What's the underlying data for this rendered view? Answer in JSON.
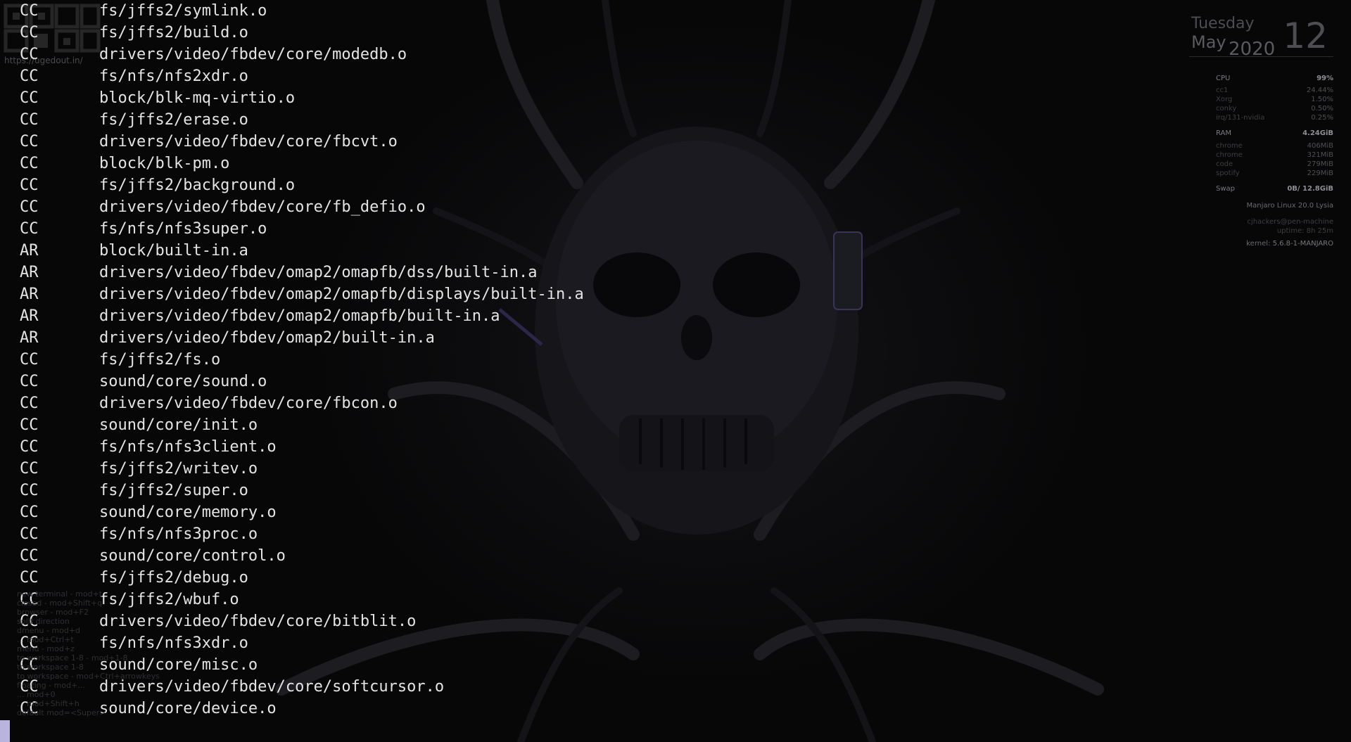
{
  "terminal": {
    "lines": [
      {
        "cmd": "CC",
        "path": "fs/jffs2/symlink.o"
      },
      {
        "cmd": "CC",
        "path": "fs/jffs2/build.o"
      },
      {
        "cmd": "CC",
        "path": "drivers/video/fbdev/core/modedb.o"
      },
      {
        "cmd": "CC",
        "path": "fs/nfs/nfs2xdr.o"
      },
      {
        "cmd": "CC",
        "path": "block/blk-mq-virtio.o"
      },
      {
        "cmd": "CC",
        "path": "fs/jffs2/erase.o"
      },
      {
        "cmd": "CC",
        "path": "drivers/video/fbdev/core/fbcvt.o"
      },
      {
        "cmd": "CC",
        "path": "block/blk-pm.o"
      },
      {
        "cmd": "CC",
        "path": "fs/jffs2/background.o"
      },
      {
        "cmd": "CC",
        "path": "drivers/video/fbdev/core/fb_defio.o"
      },
      {
        "cmd": "CC",
        "path": "fs/nfs/nfs3super.o"
      },
      {
        "cmd": "AR",
        "path": "block/built-in.a"
      },
      {
        "cmd": "AR",
        "path": "drivers/video/fbdev/omap2/omapfb/dss/built-in.a"
      },
      {
        "cmd": "AR",
        "path": "drivers/video/fbdev/omap2/omapfb/displays/built-in.a"
      },
      {
        "cmd": "AR",
        "path": "drivers/video/fbdev/omap2/omapfb/built-in.a"
      },
      {
        "cmd": "AR",
        "path": "drivers/video/fbdev/omap2/built-in.a"
      },
      {
        "cmd": "CC",
        "path": "fs/jffs2/fs.o"
      },
      {
        "cmd": "CC",
        "path": "sound/core/sound.o"
      },
      {
        "cmd": "CC",
        "path": "drivers/video/fbdev/core/fbcon.o"
      },
      {
        "cmd": "CC",
        "path": "sound/core/init.o"
      },
      {
        "cmd": "CC",
        "path": "fs/nfs/nfs3client.o"
      },
      {
        "cmd": "CC",
        "path": "fs/jffs2/writev.o"
      },
      {
        "cmd": "CC",
        "path": "fs/jffs2/super.o"
      },
      {
        "cmd": "CC",
        "path": "sound/core/memory.o"
      },
      {
        "cmd": "CC",
        "path": "fs/nfs/nfs3proc.o"
      },
      {
        "cmd": "CC",
        "path": "sound/core/control.o"
      },
      {
        "cmd": "CC",
        "path": "fs/jffs2/debug.o"
      },
      {
        "cmd": "CC",
        "path": "fs/jffs2/wbuf.o"
      },
      {
        "cmd": "CC",
        "path": "drivers/video/fbdev/core/bitblit.o"
      },
      {
        "cmd": "CC",
        "path": "fs/nfs/nfs3xdr.o"
      },
      {
        "cmd": "CC",
        "path": "sound/core/misc.o"
      },
      {
        "cmd": "CC",
        "path": "drivers/video/fbdev/core/softcursor.o"
      },
      {
        "cmd": "CC",
        "path": "sound/core/device.o"
      }
    ]
  },
  "logo": {
    "url": "https://ugedout.in/"
  },
  "hints": [
    "new terminal - mod+t",
    "closed - mod+Shift+q",
    "browser - mod+F2",
    "split direction",
    "dmenu - mod+d",
    "... mod+Ctrl+t",
    "menu - mod+z",
    "to workspace 1-8 - mod+1-8",
    "to workspace 1-8",
    "to workspace - mod+Ctrl+arrowkeys",
    "floating - mod+...",
    "... mod+0",
    "... mod+Shift+h",
    "default mod=<Super>"
  ],
  "conky": {
    "day_name": "Tuesday",
    "month": "May",
    "year": "2020",
    "day_number": "12",
    "cpu": {
      "label": "CPU",
      "value": "99%",
      "processes": [
        {
          "name": "cc1",
          "value": "24.44%"
        },
        {
          "name": "Xorg",
          "value": "1.50%"
        },
        {
          "name": "conky",
          "value": "0.50%"
        },
        {
          "name": "irq/131-nvidia",
          "value": "0.25%"
        }
      ]
    },
    "ram": {
      "label": "RAM",
      "value": "4.24GiB",
      "processes": [
        {
          "name": "chrome",
          "value": "406MiB"
        },
        {
          "name": "chrome",
          "value": "321MiB"
        },
        {
          "name": "code",
          "value": "279MiB"
        },
        {
          "name": "spotify",
          "value": "229MiB"
        }
      ]
    },
    "swap": {
      "label": "Swap",
      "value": "0B/ 12.8GiB"
    },
    "os": "Manjaro Linux 20.0 Lysia",
    "user_host": "cjhackers@pen-machine",
    "uptime": "uptime: 8h 25m",
    "kernel_label": "kernel:",
    "kernel_value": "5.6.8-1-MANJARO"
  },
  "colors": {
    "background": "#070708",
    "terminal_text": "#e4e4e4",
    "cursor": "#b9b4dc"
  }
}
